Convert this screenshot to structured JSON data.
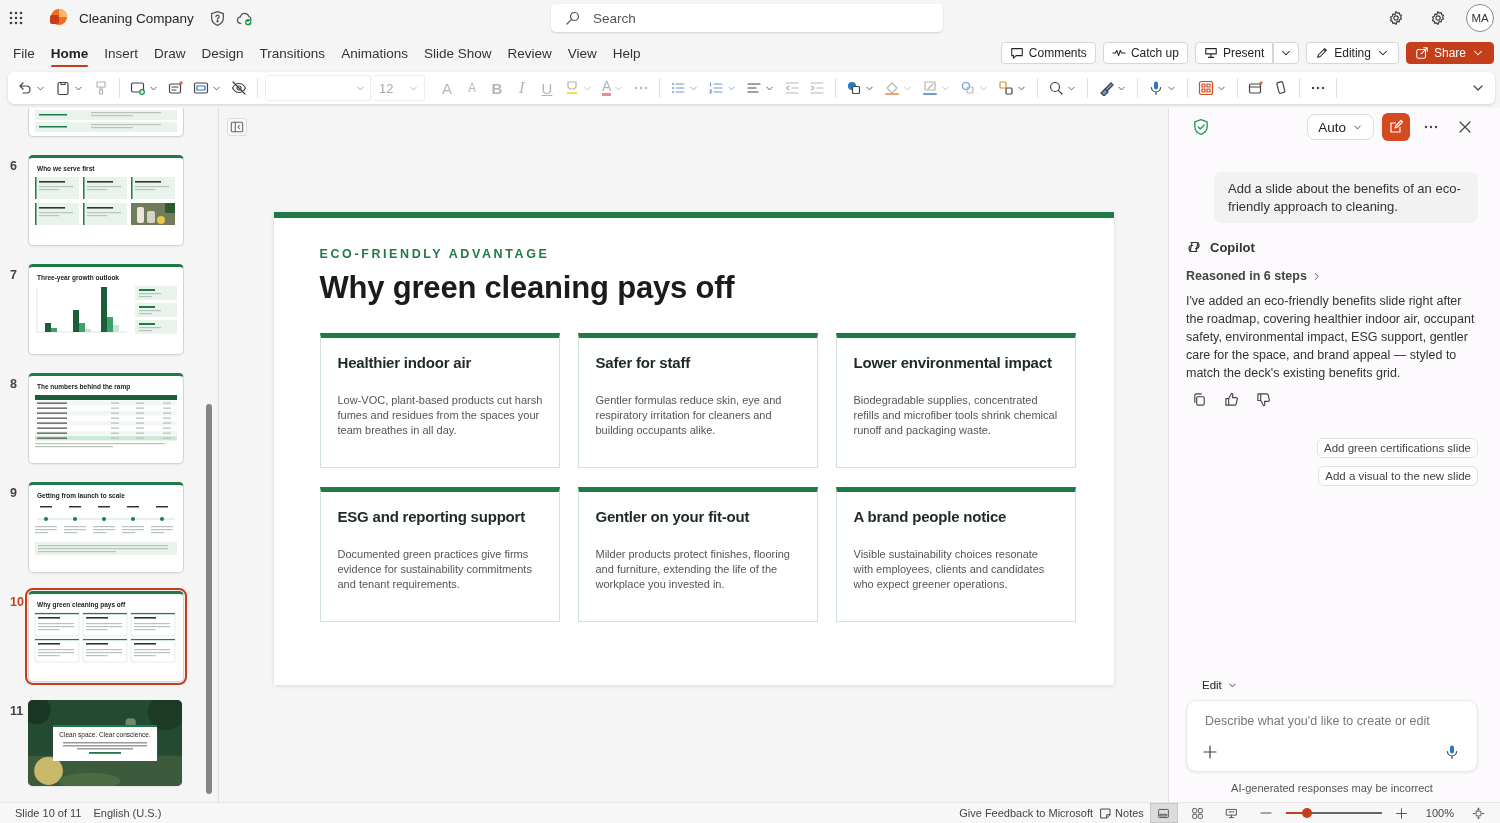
{
  "app": {
    "title": "Cleaning Company",
    "search_placeholder": "Search",
    "avatar": "MA"
  },
  "menu_tabs": [
    {
      "label": "File",
      "selected": false
    },
    {
      "label": "Home",
      "selected": true
    },
    {
      "label": "Insert",
      "selected": false
    },
    {
      "label": "Draw",
      "selected": false
    },
    {
      "label": "Design",
      "selected": false
    },
    {
      "label": "Transitions",
      "selected": false
    },
    {
      "label": "Animations",
      "selected": false
    },
    {
      "label": "Slide Show",
      "selected": false
    },
    {
      "label": "Review",
      "selected": false
    },
    {
      "label": "View",
      "selected": false
    },
    {
      "label": "Help",
      "selected": false
    }
  ],
  "actions": [
    {
      "label": "Comments",
      "kind": "comments"
    },
    {
      "label": "Catch up",
      "kind": "catchup"
    },
    {
      "label": "Present",
      "kind": "present"
    },
    {
      "label": "Editing",
      "kind": "editing"
    },
    {
      "label": "Share",
      "kind": "share"
    }
  ],
  "ribbon": {
    "font_size": "12",
    "text_format": [
      {
        "kind": "grow",
        "glyph": "A"
      },
      {
        "kind": "shrink",
        "glyph": "A"
      },
      {
        "kind": "bold",
        "glyph": "B"
      },
      {
        "kind": "italic",
        "glyph": "I"
      },
      {
        "kind": "underline",
        "glyph": "U"
      }
    ],
    "font_color_glyph": "A"
  },
  "thumbnails": [
    {
      "kind": "rows",
      "selected": false
    },
    {
      "number": "6",
      "title": "Who we serve first",
      "kind": "cards",
      "selected": false
    },
    {
      "number": "7",
      "title": "Three-year growth outlook",
      "kind": "chart",
      "selected": false
    },
    {
      "number": "8",
      "title": "The numbers behind the ramp",
      "kind": "table",
      "selected": false
    },
    {
      "number": "9",
      "title": "Getting from launch to scale",
      "kind": "timeline",
      "selected": false
    },
    {
      "number": "10",
      "title": "Why green cleaning pays off",
      "kind": "grid",
      "selected": true
    },
    {
      "number": "11",
      "title": "Clean space. Clear conscience.",
      "selected": false
    }
  ],
  "slide": {
    "eyebrow": "ECO-FRIENDLY ADVANTAGE",
    "title": "Why green cleaning pays off",
    "cards": [
      {
        "heading": "Healthier indoor air",
        "body": "Low-VOC, plant-based products cut harsh fumes and residues from the spaces your team breathes in all day."
      },
      {
        "heading": "Safer for staff",
        "body": "Gentler formulas reduce skin, eye and respiratory irritation for cleaners and building occupants alike."
      },
      {
        "heading": "Lower environmental impact",
        "body": "Biodegradable supplies, concentrated refills and microfiber tools shrink chemical runoff and packaging waste."
      },
      {
        "heading": "ESG and reporting support",
        "body": "Documented green practices give firms evidence for sustainability commitments and tenant requirements."
      },
      {
        "heading": "Gentler on your fit-out",
        "body": "Milder products protect finishes, flooring and furniture, extending the life of the workplace you invested in."
      },
      {
        "heading": "A brand people notice",
        "body": "Visible sustainability choices resonate with employees, clients and candidates who expect greener operations."
      }
    ]
  },
  "copilot": {
    "mode": "Auto",
    "prompt": "Add a slide about the benefits of an eco-friendly approach to cleaning.",
    "sender": "Copilot",
    "reasoning": "Reasoned in 6 steps",
    "reply": "I've added an eco-friendly benefits slide right after the roadmap, covering healthier indoor air, occupant safety, environmental impact, ESG support, gentler care for the space, and brand appeal — styled to match the deck's existing benefits grid.",
    "suggestions": [
      "Add green certifications slide",
      "Add a visual to the new slide"
    ],
    "composer_mode": "Edit",
    "placeholder": "Describe what you'd like to create or edit",
    "disclaimer": "AI-generated responses may be incorrect"
  },
  "status_bar": {
    "slide": "Slide 10 of 11",
    "language": "English (U.S.)",
    "feedback": "Give Feedback to Microsoft",
    "notes": "Notes",
    "zoom": {
      "level": 0.22,
      "reading": "100%"
    }
  }
}
